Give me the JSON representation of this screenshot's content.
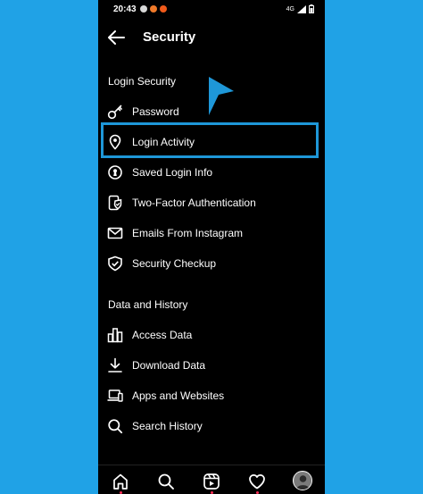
{
  "status_bar": {
    "time": "20:43",
    "network": "4G",
    "icon_colors": [
      "#e0e0e0",
      "#f07a2a",
      "#f05a1a"
    ]
  },
  "header": {
    "title": "Security",
    "back_icon": "arrow-left-icon"
  },
  "sections": {
    "login_security": {
      "title": "Login Security",
      "items": [
        {
          "label": "Password",
          "icon": "key-icon"
        },
        {
          "label": "Login Activity",
          "icon": "location-pin-icon"
        },
        {
          "label": "Saved Login Info",
          "icon": "keyhole-icon"
        },
        {
          "label": "Two-Factor Authentication",
          "icon": "phone-shield-icon"
        },
        {
          "label": "Emails From Instagram",
          "icon": "mail-icon"
        },
        {
          "label": "Security Checkup",
          "icon": "shield-check-icon"
        }
      ]
    },
    "data_history": {
      "title": "Data and History",
      "items": [
        {
          "label": "Access Data",
          "icon": "bar-chart-icon"
        },
        {
          "label": "Download Data",
          "icon": "download-icon"
        },
        {
          "label": "Apps and Websites",
          "icon": "devices-icon"
        },
        {
          "label": "Search History",
          "icon": "search-icon"
        }
      ]
    }
  },
  "annotation": {
    "highlight_color": "#1e97d8",
    "highlighted_item": "Login Activity"
  },
  "bottom_nav": [
    "home-icon",
    "search-icon",
    "reels-icon",
    "heart-icon",
    "profile-avatar"
  ],
  "colors": {
    "background": "#20a2e6",
    "app_background": "#000000",
    "text": "#ffffff",
    "notification": "#ff2d55"
  }
}
